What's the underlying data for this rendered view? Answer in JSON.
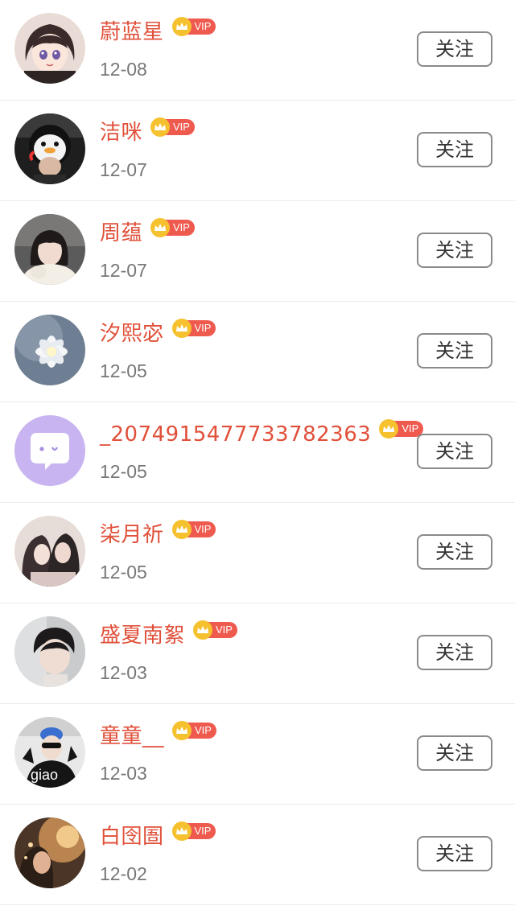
{
  "followers": [
    {
      "name": "蔚蓝星",
      "badge": "VIP",
      "date": "12-08",
      "action": "关注",
      "avatar": "anime-girl-avatar"
    },
    {
      "name": "洁咪",
      "badge": "VIP",
      "date": "12-07",
      "action": "关注",
      "avatar": "penguin-hat-avatar"
    },
    {
      "name": "周蕴",
      "badge": "VIP",
      "date": "12-07",
      "action": "关注",
      "avatar": "girl-photo-avatar"
    },
    {
      "name": "汐熙宓",
      "badge": "VIP",
      "date": "12-05",
      "action": "关注",
      "avatar": "white-flower-avatar"
    },
    {
      "name": "_2074915477733782363",
      "badge": "VIP",
      "date": "12-05",
      "action": "关注",
      "avatar": "default-chat-avatar"
    },
    {
      "name": "柒月祈",
      "badge": "VIP",
      "date": "12-05",
      "action": "关注",
      "avatar": "couple-illustration-avatar"
    },
    {
      "name": "盛夏南絮",
      "badge": "VIP",
      "date": "12-03",
      "action": "关注",
      "avatar": "boy-portrait-avatar"
    },
    {
      "name": "童童__",
      "badge": "VIP",
      "date": "12-03",
      "action": "关注",
      "avatar": "giao-avatar",
      "avatar_text": "giao"
    },
    {
      "name": "白囹圄",
      "badge": "VIP",
      "date": "12-02",
      "action": "关注",
      "avatar": "warm-light-avatar"
    }
  ],
  "colors": {
    "name": "#e0503a",
    "vip_badge": "#ef5a4f",
    "crown": "#f6c12f",
    "date": "#777777",
    "button_border": "#8a8a8a"
  }
}
